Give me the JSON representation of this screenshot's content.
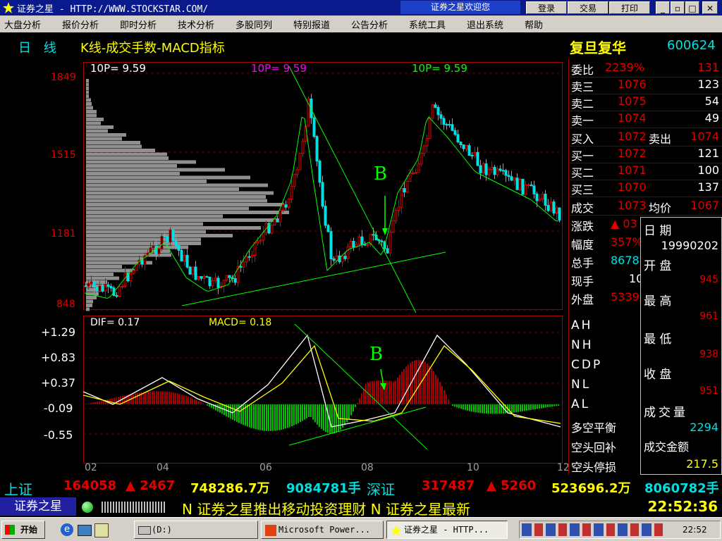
{
  "window": {
    "title": "证券之星 - HTTP://WWW.STOCKSTAR.COM/",
    "welcome": "证券之星欢迎您",
    "login": "登录",
    "trade": "交易",
    "print": "打印"
  },
  "menu": [
    "大盘分析",
    "报价分析",
    "即时分析",
    "技术分析",
    "多股同列",
    "特别报道",
    "公告分析",
    "系统工具",
    "退出系统",
    "帮助"
  ],
  "chart_header": {
    "period": "日 线",
    "title": "K线-成交手数-MACD指标",
    "stock_name": "复旦复华",
    "stock_code": "600624"
  },
  "price_axis": [
    "1849",
    "1515",
    "1181",
    "848"
  ],
  "ma_labels": [
    {
      "text": "10P=  9.59",
      "color": "#ffffff"
    },
    {
      "text": "10P=  9.59",
      "color": "#ff00ff"
    },
    {
      "text": "10P=  9.59",
      "color": "#00ff00"
    }
  ],
  "macd": {
    "dif_label": "DIF=  0.17",
    "macd_label": "MACD=  0.18",
    "axis": [
      "+1.29",
      "+0.83",
      "+0.37",
      "-0.09",
      "-0.55"
    ]
  },
  "annotation_b": "B",
  "date_axis": [
    "02",
    "04",
    "06",
    "08",
    "10",
    "12"
  ],
  "quote_panel": {
    "weibi": {
      "label": "委比",
      "pct": "2239%",
      "val": "131"
    },
    "sells": [
      {
        "label": "卖三",
        "price": "1076",
        "vol": "123"
      },
      {
        "label": "卖二",
        "price": "1075",
        "vol": "54"
      },
      {
        "label": "卖一",
        "price": "1074",
        "vol": "49"
      }
    ],
    "buy_in": {
      "label": "买入",
      "price": "1072",
      "label2": "卖出",
      "price2": "1074"
    },
    "buys": [
      {
        "label": "买一",
        "price": "1072",
        "vol": "121"
      },
      {
        "label": "买二",
        "price": "1071",
        "vol": "100"
      },
      {
        "label": "买三",
        "price": "1070",
        "vol": "137"
      }
    ],
    "chengjiao": {
      "label": "成交",
      "price": "1073",
      "label2": "均价",
      "val": "1067"
    },
    "zhangdie": {
      "label": "涨跌",
      "val": "▲ 03"
    },
    "fudu": {
      "label": "幅度",
      "val": "357%"
    },
    "zongshou": {
      "label": "总手",
      "val": "8678"
    },
    "xianshou": {
      "label": "现手",
      "val": "10"
    },
    "waipan": {
      "label": "外盘",
      "val": "5339"
    },
    "indicators": [
      "AH",
      "NH",
      "CDP",
      "NL",
      "AL"
    ],
    "signals": [
      "多空平衡",
      "空头回补",
      "空头停损"
    ]
  },
  "info_popup": {
    "date_label": "日  期",
    "date": "19990202",
    "open_label": "开  盘",
    "open": "945",
    "high_label": "最  高",
    "high": "961",
    "low_label": "最  低",
    "low": "938",
    "close_label": "收  盘",
    "close": "951",
    "vol_label": "成交量",
    "vol": "2294",
    "amount_label": "成交金额",
    "amount": "217.5"
  },
  "ticker": {
    "sh_label": "上证",
    "sh_index": "164058",
    "sh_change": "▲ 2467",
    "sh_amount": "748286.7万",
    "sh_vol": "9084781手",
    "sz_label": "深证",
    "sz_index": "317487",
    "sz_change": "▲ 5260",
    "sz_amount": "523696.2万",
    "sz_vol": "8060782手"
  },
  "status": {
    "brand": "证券之星",
    "news": "N 证券之星推出移动投资理财  N 证券之星最新",
    "time": "22:52:36"
  },
  "taskbar": {
    "start": "开始",
    "drive": "(D:)",
    "ppt": "Microsoft Power...",
    "ie": "证券之星 - HTTP...",
    "clock": "22:52"
  },
  "colors": {
    "up": "#e00000",
    "down": "#00e0e0",
    "ma": "#00ff00",
    "grid": "#800000"
  }
}
